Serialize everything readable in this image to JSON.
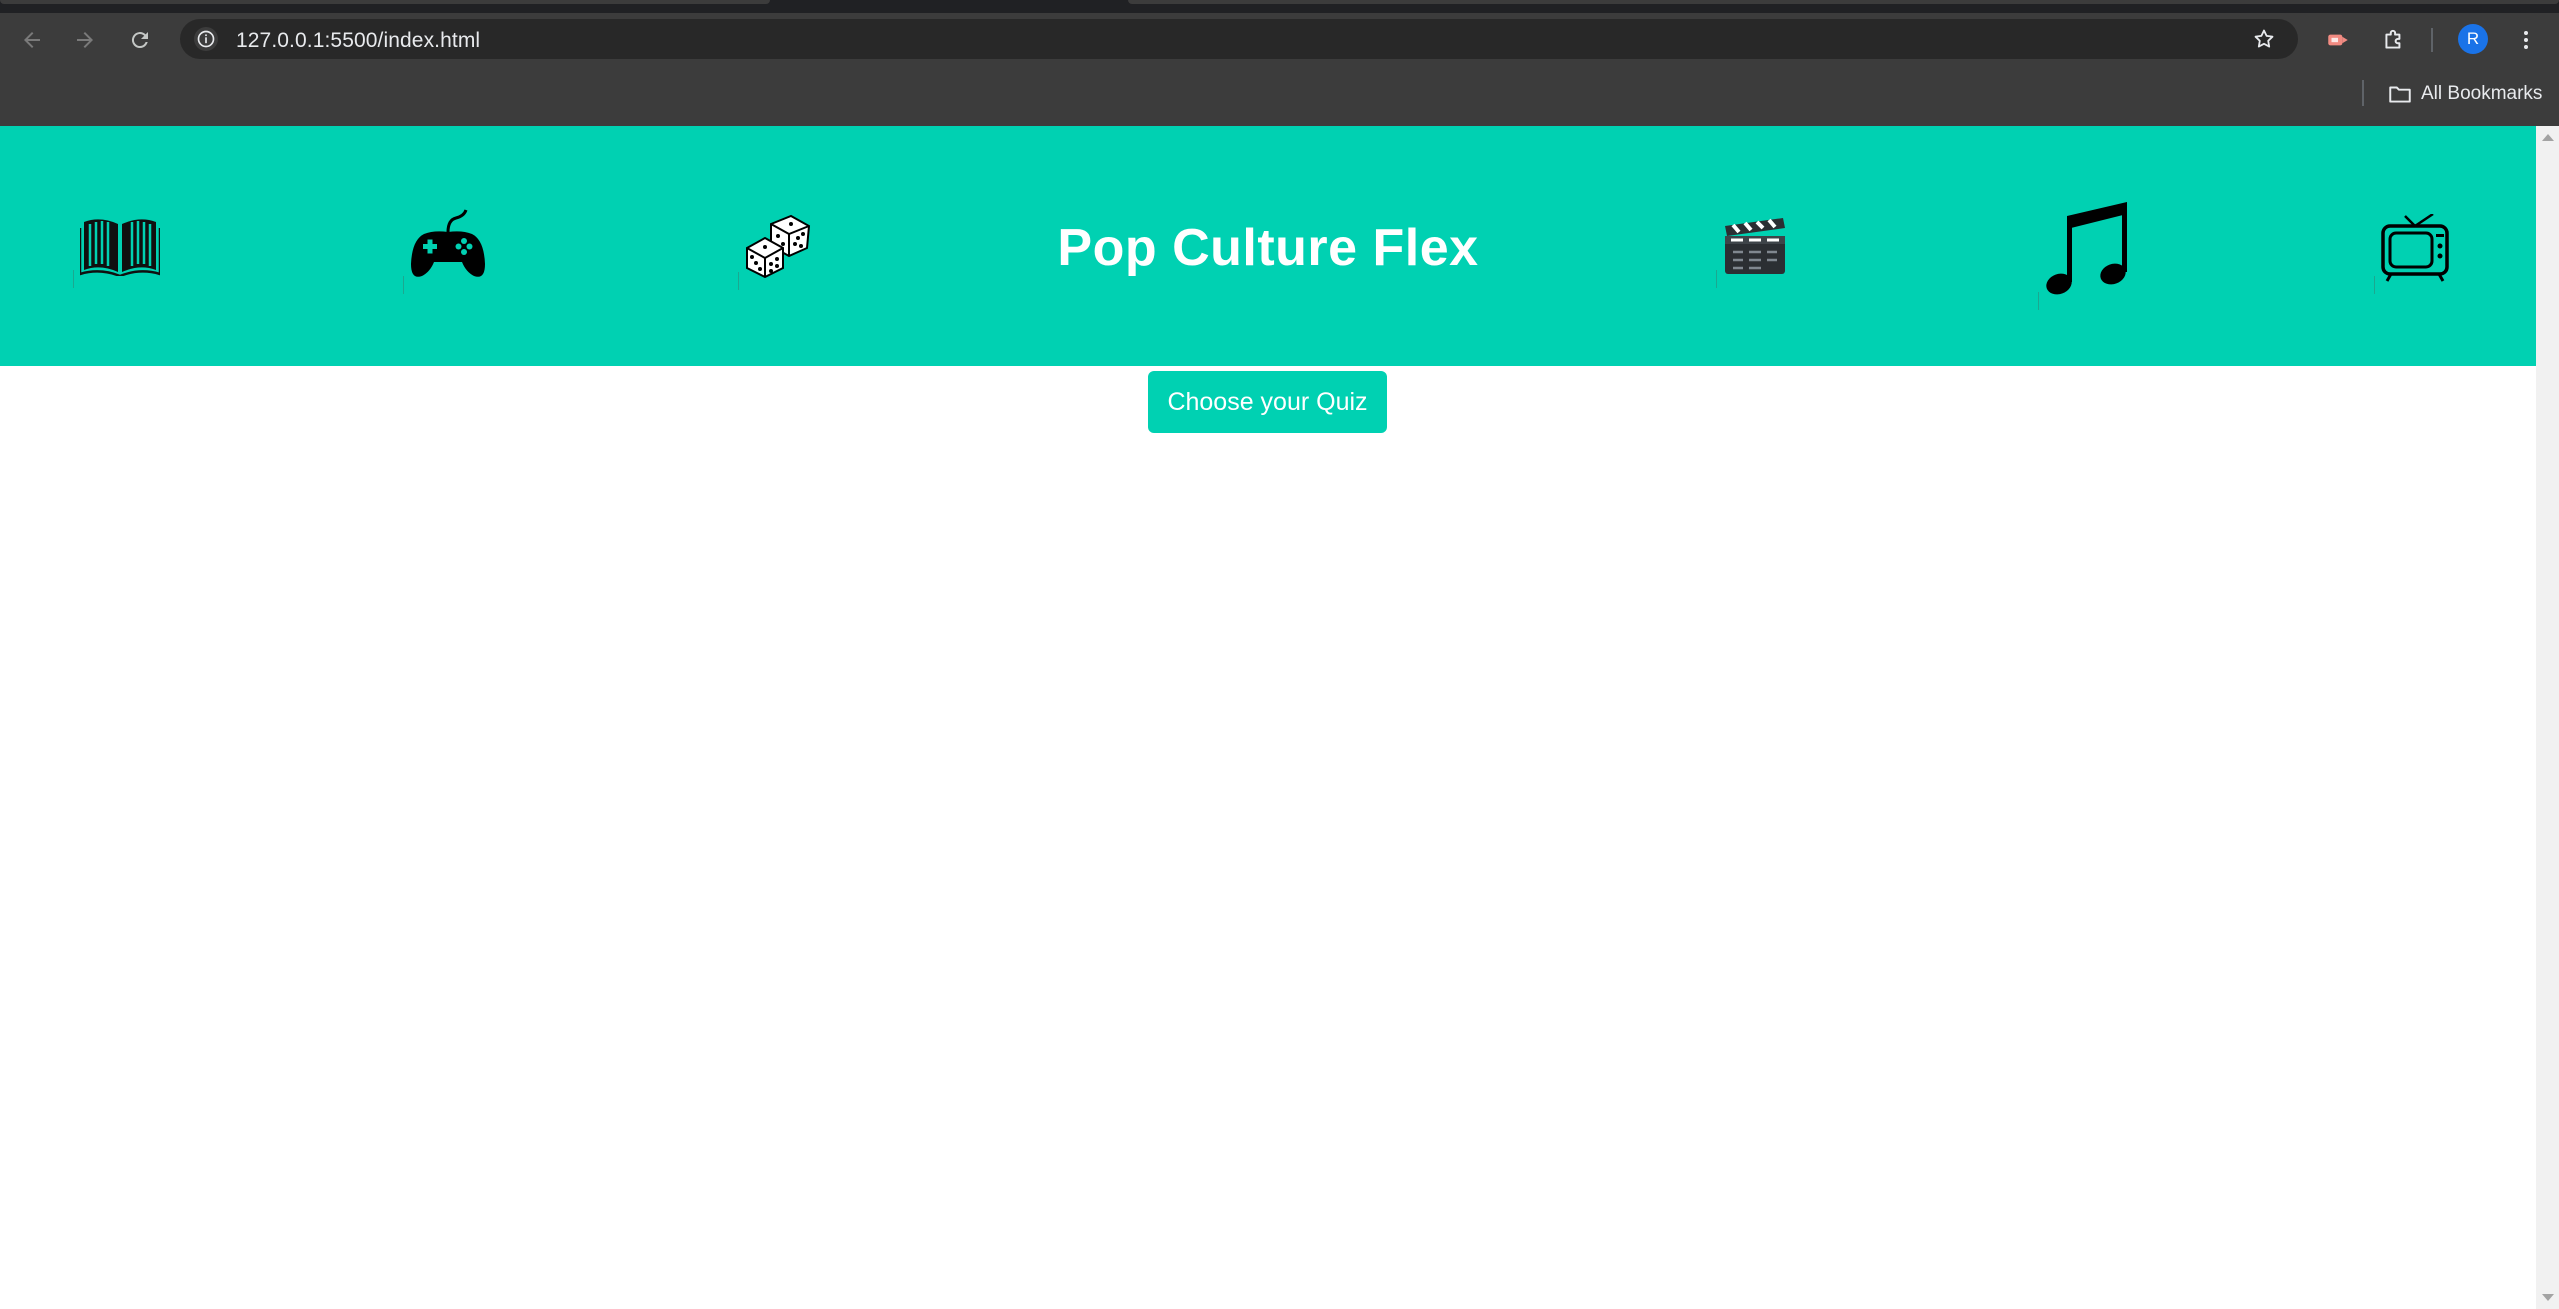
{
  "browser": {
    "url": "127.0.0.1:5500/index.html",
    "bookmarks_label": "All Bookmarks",
    "profile_initial": "R",
    "icons": [
      "back-arrow-icon",
      "forward-arrow-icon",
      "reload-icon",
      "site-info-icon",
      "bookmark-star-icon",
      "cast-extension-icon",
      "extensions-puzzle-icon",
      "more-menu-icon",
      "folder-icon"
    ]
  },
  "hero": {
    "title": "Pop Culture Flex",
    "background_color": "#00d1b2",
    "icons": [
      "open-book-icon",
      "game-controller-icon",
      "dice-icon",
      "clapperboard-icon",
      "music-note-icon",
      "tv-icon"
    ]
  },
  "main": {
    "choose_quiz_label": "Choose your Quiz",
    "button_color": "#00d1b2"
  }
}
